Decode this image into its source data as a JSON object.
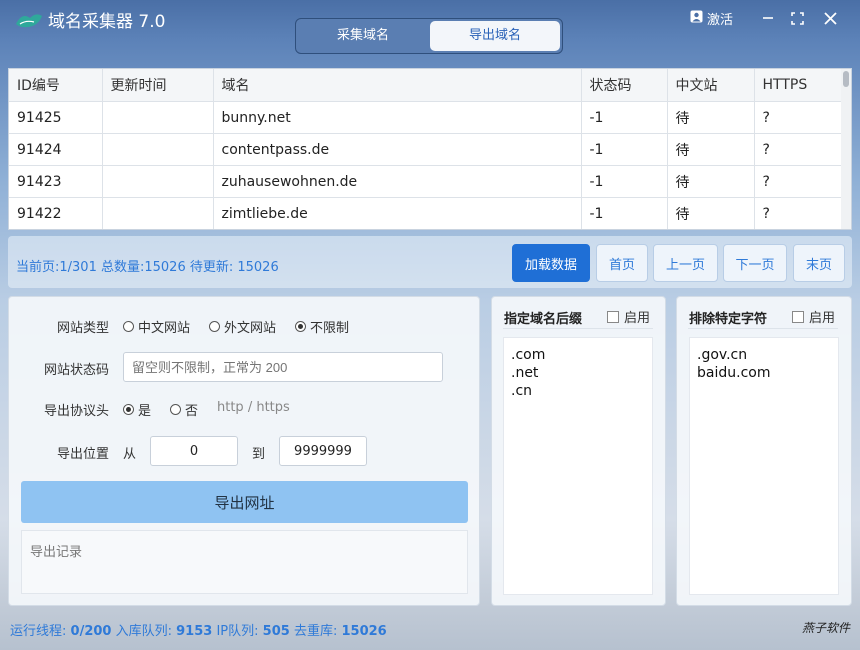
{
  "app": {
    "title": "域名采集器 7.0",
    "tabs": [
      "采集域名",
      "导出域名"
    ],
    "active_tab": "导出域名",
    "activate_label": "激活"
  },
  "table": {
    "columns": [
      "ID编号",
      "更新时间",
      "域名",
      "状态码",
      "中文站",
      "HTTPS"
    ],
    "rows": [
      [
        "91425",
        "",
        "bunny.net",
        "-1",
        "待",
        "?"
      ],
      [
        "91424",
        "",
        "contentpass.de",
        "-1",
        "待",
        "?"
      ],
      [
        "91423",
        "",
        "zuhausewohnen.de",
        "-1",
        "待",
        "?"
      ],
      [
        "91422",
        "",
        "zimtliebe.de",
        "-1",
        "待",
        "?"
      ]
    ]
  },
  "pagination": {
    "info": "当前页:1/301 总数量:15026 待更新: 15026",
    "buttons": [
      "加载数据",
      "首页",
      "上一页",
      "下一页",
      "末页"
    ]
  },
  "export": {
    "site_type_label": "网站类型",
    "site_type_options": [
      "中文网站",
      "外文网站",
      "不限制"
    ],
    "site_type_selected": "不限制",
    "status_code_label": "网站状态码",
    "status_code_placeholder": "留空则不限制，正常为 200",
    "protocol_label": "导出协议头",
    "protocol_options": [
      "是",
      "否"
    ],
    "protocol_selected": "是",
    "protocol_hint": "http / https",
    "position_label": "导出位置",
    "from_label": "从",
    "from_value": "0",
    "to_label": "到",
    "to_value": "9999999",
    "export_button": "导出网址",
    "log_placeholder": "导出记录"
  },
  "suffix_panel": {
    "title": "指定域名后缀",
    "enable_label": "启用",
    "enabled": false,
    "items": [
      ".com",
      ".net",
      ".cn"
    ]
  },
  "exclude_panel": {
    "title": "排除特定字符",
    "enable_label": "启用",
    "enabled": false,
    "items": [
      ".gov.cn",
      "baidu.com"
    ]
  },
  "statusbar": {
    "threads_label": "运行线程:",
    "threads_value": "0/200",
    "queue_label": "入库队列:",
    "queue_value": "9153",
    "ip_label": "IP队列:",
    "ip_value": "505",
    "dedupe_label": "去重库:",
    "dedupe_value": "15026",
    "brand": "燕子软件"
  }
}
